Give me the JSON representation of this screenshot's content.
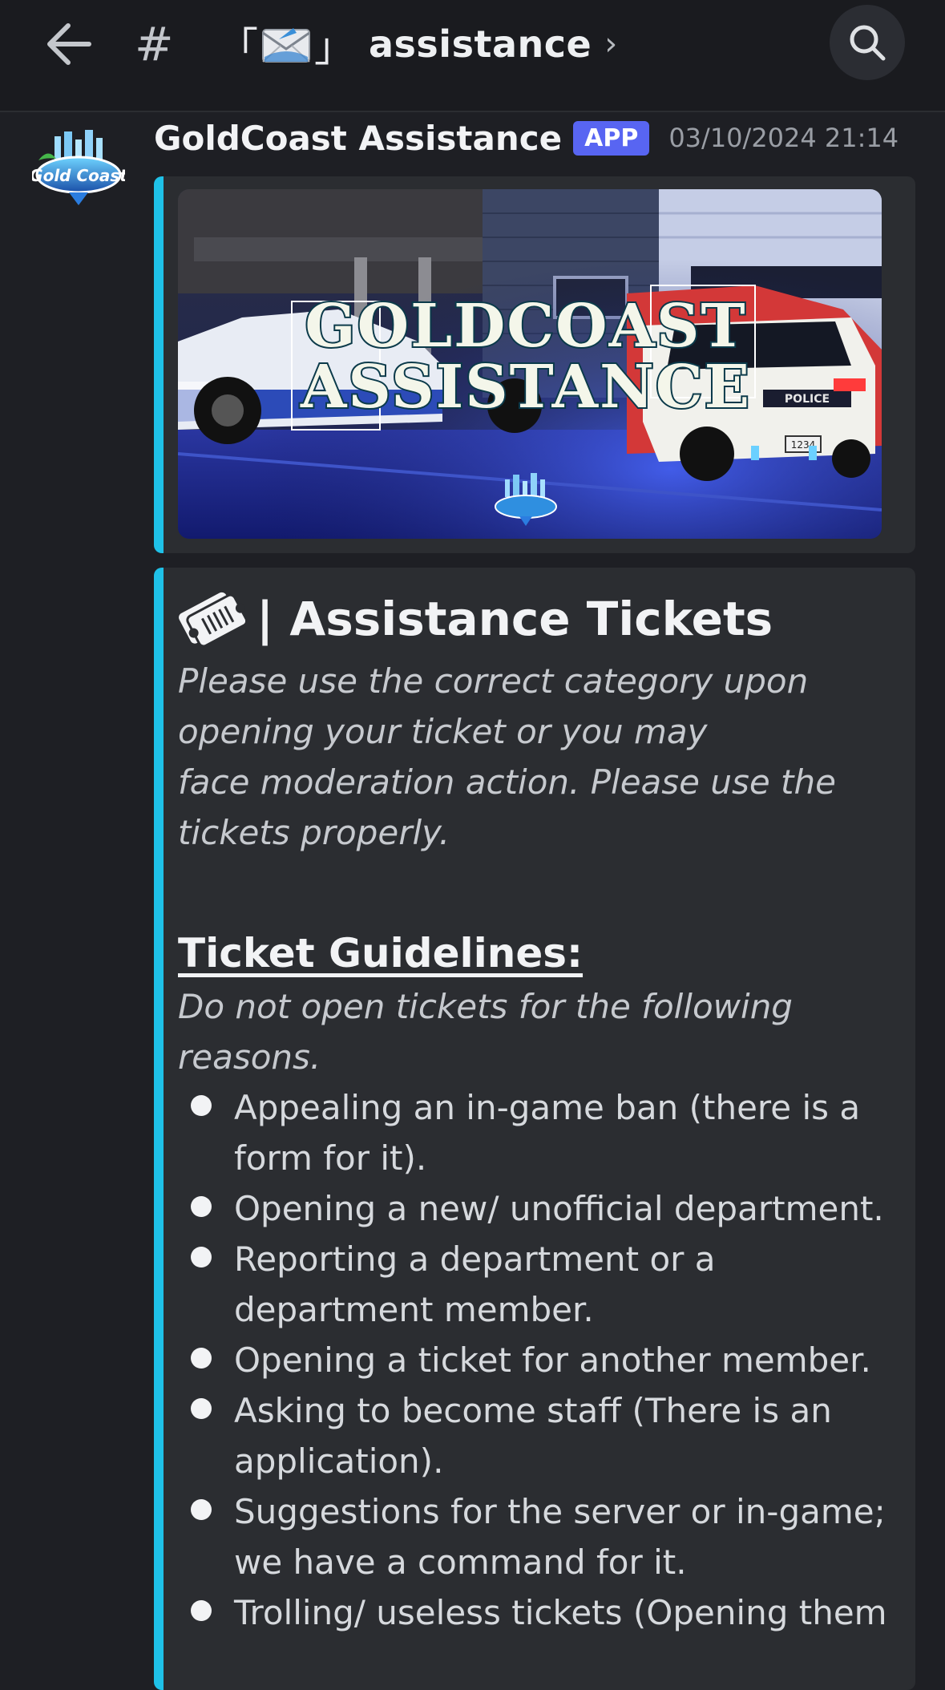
{
  "header": {
    "channel_prefix": "#",
    "bracket_left": "「",
    "bracket_right": "」",
    "channel_name": "assistance",
    "chevron": "›",
    "icons": [
      "back-arrow-icon",
      "envelope-icon",
      "search-icon"
    ]
  },
  "message": {
    "author": "GoldCoast Assistance",
    "badge": "APP",
    "timestamp": "03/10/2024 21:14",
    "avatar_text": "Gold Coast"
  },
  "banner": {
    "line1": "GOLDCOAST",
    "line2": "ASSISTANCE",
    "plate": "POLICE",
    "plate_number": "1234"
  },
  "embed": {
    "accent_color": "#1fc1e8",
    "title": "| Assistance Tickets",
    "intro": [
      "Please use the correct category upon",
      "opening your ticket or you may",
      "face moderation action. Please use the",
      "tickets properly."
    ],
    "guidelines_heading": "Ticket Guidelines:",
    "guidelines_sub": [
      "Do not open tickets for the following",
      "reasons."
    ],
    "items": [
      "Appealing an in-game ban (there is a form for it).",
      "Opening a new/ unofficial department.",
      "Reporting a department or a department member.",
      "Opening a ticket for another member.",
      "Asking to become staff (There is an application).",
      "Suggestions for the server or in-game; we have a command for it.",
      "Trolling/ useless tickets (Opening them"
    ]
  }
}
